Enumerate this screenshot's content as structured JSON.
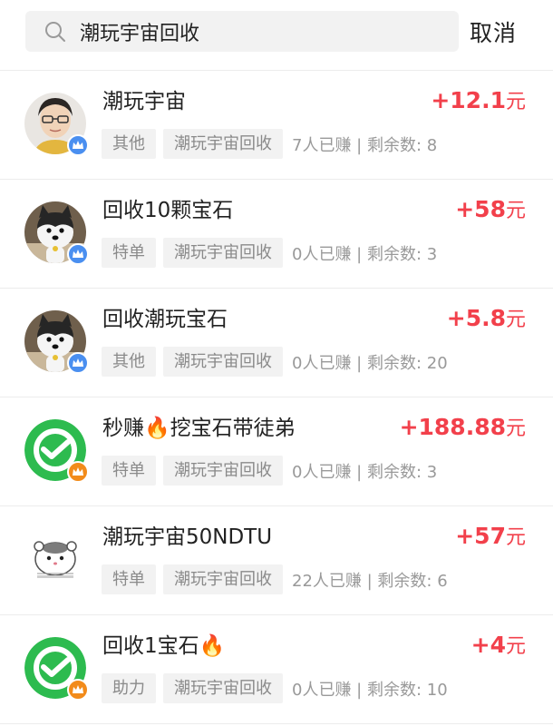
{
  "search": {
    "query": "潮玩宇宙回收"
  },
  "header": {
    "cancel_label": "取消"
  },
  "colors": {
    "accent": "#f2404b",
    "tag_bg": "#f2f2f2",
    "badge_blue": "#4a8ff0",
    "badge_orange": "#f28b1b"
  },
  "items": [
    {
      "title": "潮玩宇宙",
      "reward": "+12.1",
      "unit": "元",
      "tag1": "其他",
      "tag2": "潮玩宇宙回收",
      "stats": "7人已赚 | 剩余数: 8",
      "avatar": "woman-glasses-photo",
      "badge": "blue-crown"
    },
    {
      "title": "回收10颗宝石",
      "reward": "+58",
      "unit": "元",
      "tag1": "特单",
      "tag2": "潮玩宇宙回收",
      "stats": "0人已赚 | 剩余数: 3",
      "avatar": "husky-dog",
      "badge": "blue-crown"
    },
    {
      "title": "回收潮玩宝石",
      "reward": "+5.8",
      "unit": "元",
      "tag1": "其他",
      "tag2": "潮玩宇宙回收",
      "stats": "0人已赚 | 剩余数: 20",
      "avatar": "husky-dog",
      "badge": "blue-crown"
    },
    {
      "title": "秒赚🔥挖宝石带徒弟",
      "reward": "+188.88",
      "unit": "元",
      "tag1": "特单",
      "tag2": "潮玩宇宙回收",
      "stats": "0人已赚 | 剩余数: 3",
      "avatar": "wechat-logo",
      "badge": "orange-crown"
    },
    {
      "title": "潮玩宇宙50NDTU",
      "reward": "+57",
      "unit": "元",
      "tag1": "特单",
      "tag2": "潮玩宇宙回收",
      "stats": "22人已赚 | 剩余数: 6",
      "avatar": "cartoon-hamster",
      "badge": ""
    },
    {
      "title": "回收1宝石🔥",
      "reward": "+4",
      "unit": "元",
      "tag1": "助力",
      "tag2": "潮玩宇宙回收",
      "stats": "0人已赚 | 剩余数: 10",
      "avatar": "wechat-logo",
      "badge": "orange-crown"
    }
  ]
}
